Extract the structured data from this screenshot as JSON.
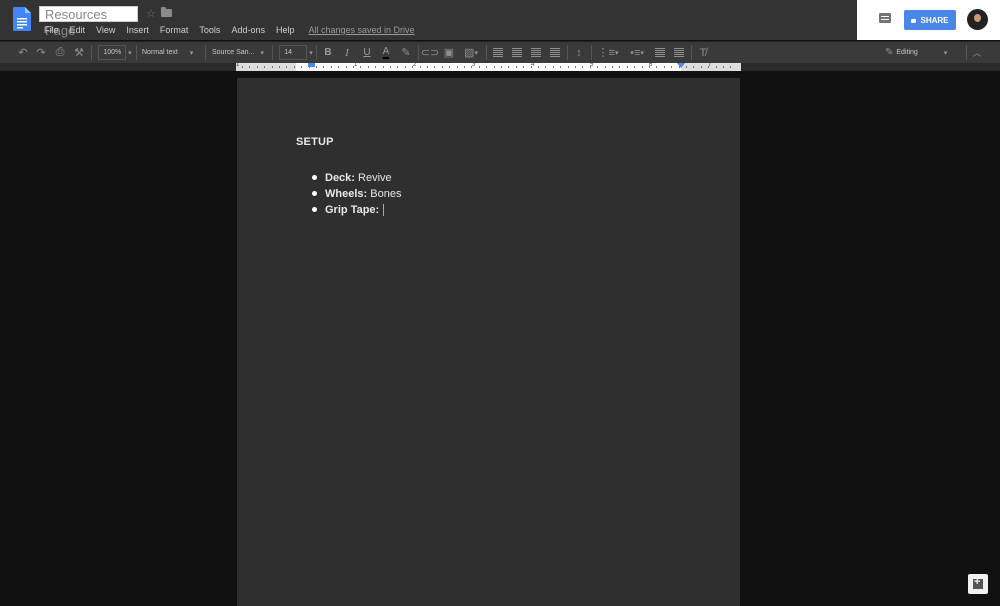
{
  "header": {
    "doc_title": "Resources Page",
    "menu": [
      "File",
      "Edit",
      "View",
      "Insert",
      "Format",
      "Tools",
      "Add-ons",
      "Help"
    ],
    "save_status": "All changes saved in Drive",
    "share_label": "SHARE"
  },
  "toolbar": {
    "zoom": "100%",
    "style": "Normal text",
    "font": "Source San...",
    "font_size": "14",
    "mode": "Editing"
  },
  "ruler": {
    "numbers": [
      "1",
      "1",
      "2",
      "3",
      "4",
      "5",
      "6",
      "7"
    ]
  },
  "document": {
    "heading": "SETUP",
    "items": [
      {
        "label": "Deck:",
        "value": "Revive"
      },
      {
        "label": "Wheels:",
        "value": "Bones"
      },
      {
        "label": "Grip Tape:",
        "value": ""
      }
    ]
  },
  "colors": {
    "accent": "#4a86e8",
    "background": "#111111",
    "page": "#2f2f2f"
  }
}
